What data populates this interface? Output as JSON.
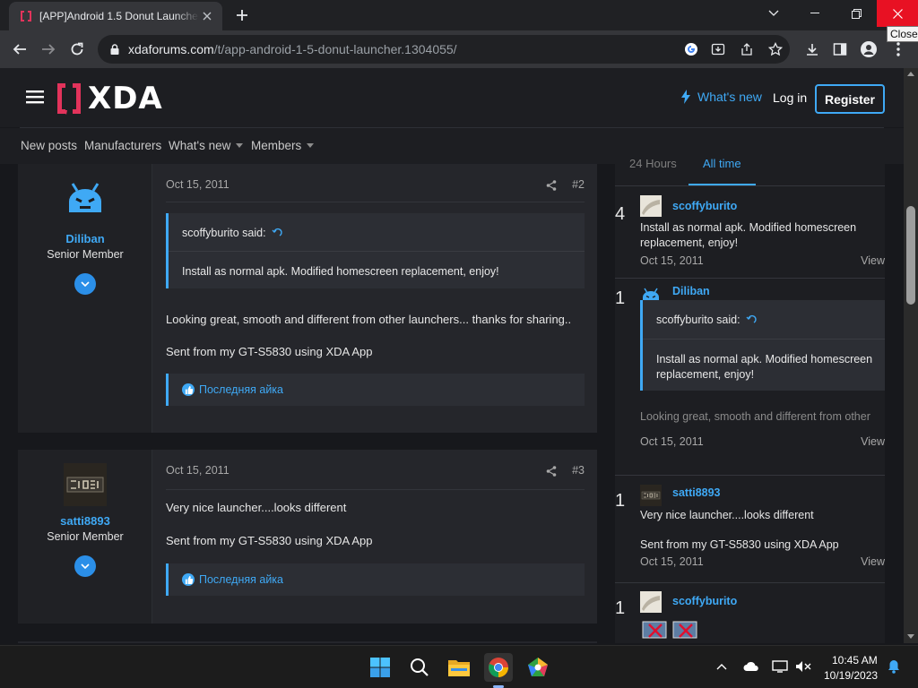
{
  "browser": {
    "tab_title": "[APP]Android 1.5 Donut Launcher",
    "url_domain": "xdaforums.com",
    "url_path": "/t/app-android-1-5-donut-launcher.1304055/",
    "close_tooltip": "Close"
  },
  "header": {
    "logo": "XDA",
    "whats_new": "What's new",
    "login": "Log in",
    "register": "Register"
  },
  "nav": {
    "items": [
      "New posts",
      "Manufacturers",
      "What's new",
      "Members"
    ]
  },
  "posts": [
    {
      "author": "Diliban",
      "role": "Senior Member",
      "date": "Oct 15, 2011",
      "number": "#2",
      "quote_author": "scoffyburito said:",
      "quote_text": "Install as normal apk. Modified homescreen replacement, enjoy!",
      "text1": "Looking great, smooth and different from other launchers... thanks for sharing..",
      "text2": "Sent from my GT-S5830 using XDA App",
      "reaction": "Последняя айка"
    },
    {
      "author": "satti8893",
      "role": "Senior Member",
      "date": "Oct 15, 2011",
      "number": "#3",
      "text1": "Very nice launcher....looks different",
      "text2": "Sent from my GT-S5830 using XDA App",
      "reaction": "Последняя айка"
    }
  ],
  "sidebar": {
    "tab_24h": "24 Hours",
    "tab_all": "All time",
    "items": [
      {
        "rank": "4",
        "author": "scoffyburito",
        "text": "Install as normal apk. Modified homescreen replacement, enjoy!",
        "date": "Oct 15, 2011",
        "view": "View"
      },
      {
        "rank": "1",
        "author": "Diliban",
        "quote_author": "scoffyburito said:",
        "quote_text": "Install as normal apk. Modified homescreen replacement, enjoy!",
        "text": "Looking great, smooth and different from other",
        "date": "Oct 15, 2011",
        "view": "View"
      },
      {
        "rank": "1",
        "author": "satti8893",
        "text": "Very nice launcher....looks different",
        "text2": "Sent from my GT-S5830 using XDA App",
        "date": "Oct 15, 2011",
        "view": "View"
      },
      {
        "rank": "1",
        "author": "scoffyburito"
      }
    ]
  },
  "taskbar": {
    "time": "10:45 AM",
    "date": "10/19/2023"
  },
  "colors": {
    "accent": "#3fa9f5",
    "brand_red": "#e2335b",
    "close_red": "#e81123"
  }
}
